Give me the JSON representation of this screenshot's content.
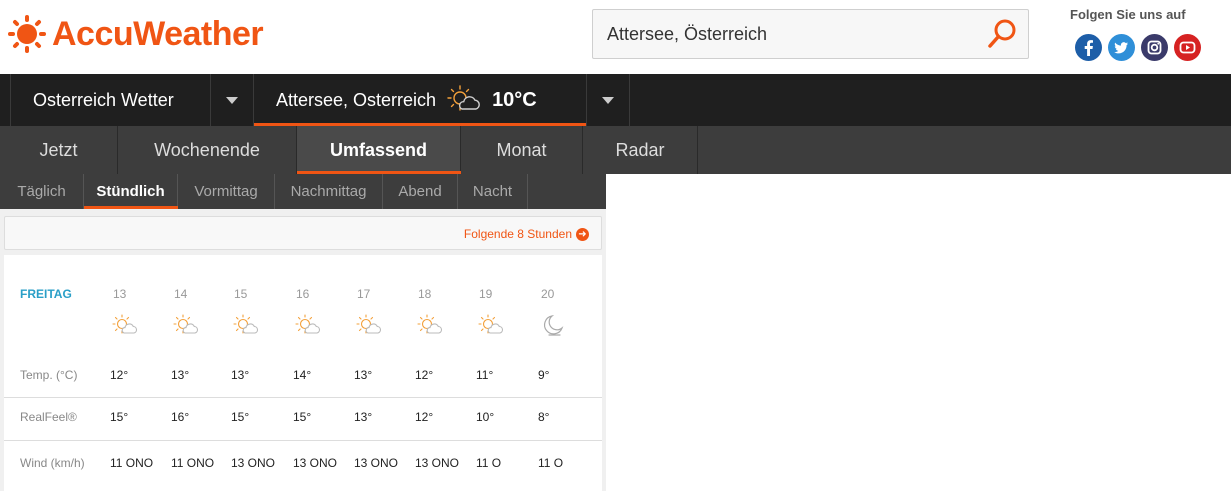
{
  "brand": {
    "name": "AccuWeather",
    "color": "#f05514"
  },
  "search": {
    "value": "Attersee, Österreich",
    "icon": "search-icon"
  },
  "follow": {
    "label": "Folgen Sie uns auf",
    "icons": [
      "facebook-icon",
      "twitter-icon",
      "instagram-icon",
      "youtube-icon"
    ]
  },
  "nav1": {
    "country": "Osterreich Wetter",
    "location": "Attersee, Osterreich",
    "temperature": "10°C"
  },
  "nav2": {
    "items": [
      "Jetzt",
      "Wochenende",
      "Umfassend",
      "Monat",
      "Radar"
    ],
    "active": "Umfassend"
  },
  "tabs": {
    "items": [
      "Täglich",
      "Stündlich",
      "Vormittag",
      "Nachmittag",
      "Abend",
      "Nacht"
    ],
    "active": "Stündlich"
  },
  "next_link": "Folgende 8 Stunden",
  "forecast": {
    "day": "FREITAG",
    "hours": [
      "13",
      "14",
      "15",
      "16",
      "17",
      "18",
      "19",
      "20"
    ],
    "icons": [
      "partly-sunny-icon",
      "partly-sunny-icon",
      "partly-sunny-icon",
      "partly-sunny-icon",
      "partly-sunny-icon",
      "partly-sunny-icon",
      "partly-sunny-icon",
      "moon-icon"
    ],
    "rows": [
      {
        "label": "Temp. (°C)",
        "values": [
          "12°",
          "13°",
          "13°",
          "14°",
          "13°",
          "12°",
          "11°",
          "9°"
        ]
      },
      {
        "label": "RealFeel®",
        "values": [
          "15°",
          "16°",
          "15°",
          "15°",
          "13°",
          "12°",
          "10°",
          "8°"
        ]
      },
      {
        "label": "Wind (km/h)",
        "values": [
          "11 ONO",
          "11 ONO",
          "13 ONO",
          "13 ONO",
          "13 ONO",
          "13 ONO",
          "11 O",
          "11 O"
        ]
      }
    ]
  }
}
